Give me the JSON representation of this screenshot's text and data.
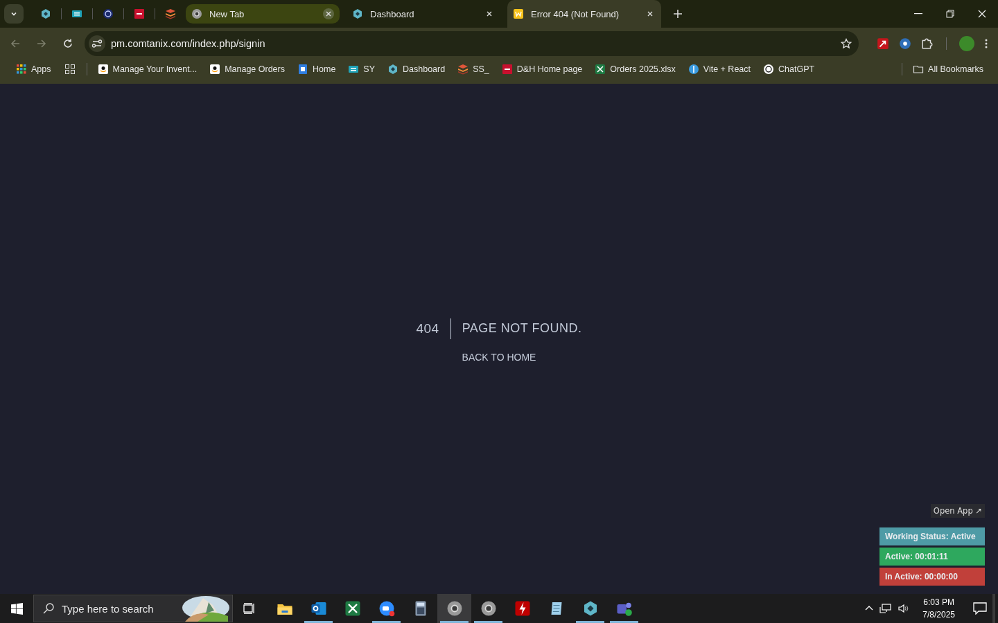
{
  "tab_strip": {
    "tabs": [
      {
        "title": "New Tab",
        "selected": false,
        "highlighted": true
      },
      {
        "title": "Dashboard",
        "selected": false,
        "highlighted": false
      },
      {
        "title": "Error 404 (Not Found)",
        "selected": true,
        "highlighted": false
      }
    ]
  },
  "address_bar": {
    "url": "pm.comtanix.com/index.php/signin"
  },
  "bookmarks_bar": {
    "apps_label": "Apps",
    "items": [
      {
        "label": "Manage Your Invent..."
      },
      {
        "label": "Manage Orders"
      },
      {
        "label": "Home"
      },
      {
        "label": "SY"
      },
      {
        "label": "Dashboard"
      },
      {
        "label": "SS_"
      },
      {
        "label": "D&H Home page"
      },
      {
        "label": "Orders 2025.xlsx"
      },
      {
        "label": "Vite + React"
      },
      {
        "label": "ChatGPT"
      }
    ],
    "all_bookmarks": "All Bookmarks"
  },
  "error_page": {
    "code": "404",
    "message": "PAGE NOT FOUND.",
    "link": "BACK TO HOME"
  },
  "status_widget": {
    "open_app": "Open App ↗",
    "items": [
      {
        "text": "Working Status: Active",
        "color": "#4e9ba6"
      },
      {
        "text": "Active: 00:01:11",
        "color": "#2ea85e"
      },
      {
        "text": "In Active: 00:00:00",
        "color": "#c1403a"
      }
    ]
  },
  "taskbar": {
    "search_placeholder": "Type here to search",
    "apps": [
      {
        "running": false,
        "selected": false
      },
      {
        "running": true,
        "selected": false
      },
      {
        "running": false,
        "selected": false
      },
      {
        "running": true,
        "selected": false
      },
      {
        "running": false,
        "selected": false
      },
      {
        "running": true,
        "selected": true
      },
      {
        "running": true,
        "selected": false
      },
      {
        "running": false,
        "selected": false
      },
      {
        "running": false,
        "selected": false
      },
      {
        "running": true,
        "selected": false
      },
      {
        "running": true,
        "selected": false
      }
    ],
    "time": "6:03 PM",
    "date": "7/8/2025"
  }
}
